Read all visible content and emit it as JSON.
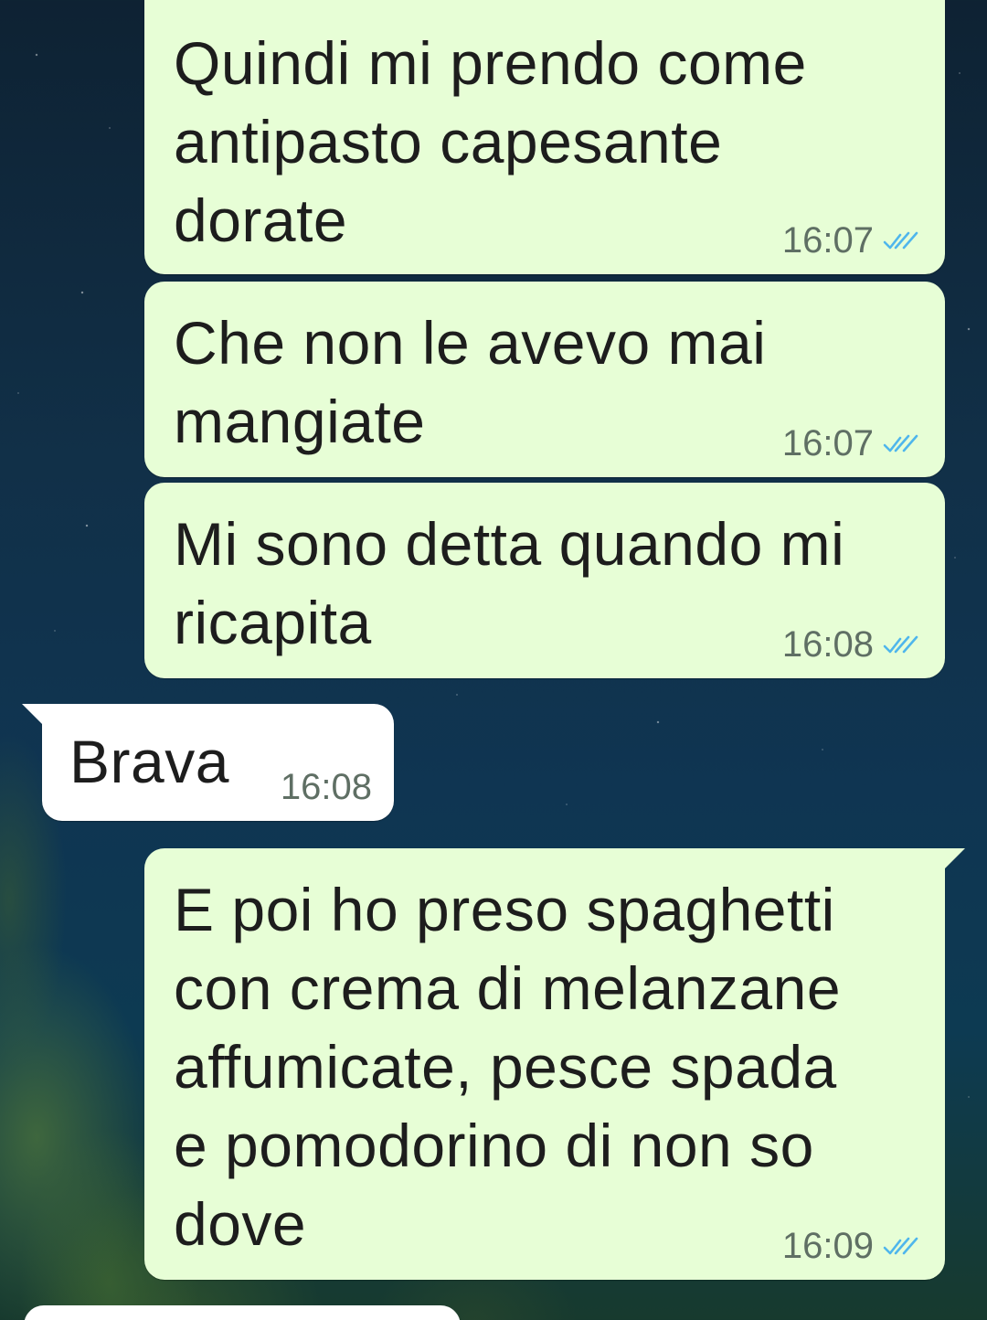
{
  "messages": [
    {
      "direction": "outgoing",
      "text": "Quindi mi prendo come\nantipasto capesante\ndorate",
      "time": "16:07",
      "status_icon": "double-check-read-icon"
    },
    {
      "direction": "outgoing",
      "text": "Che non le avevo mai\nmangiate",
      "time": "16:07",
      "status_icon": "double-check-read-icon"
    },
    {
      "direction": "outgoing",
      "text": "Mi sono detta quando mi\nricapita",
      "time": "16:08",
      "status_icon": "double-check-read-icon"
    },
    {
      "direction": "incoming",
      "text": "Brava",
      "time": "16:08"
    },
    {
      "direction": "outgoing",
      "text": "E poi ho preso spaghetti\ncon crema di melanzane\naffumicate, pesce spada\ne pomodorino di non so\ndove",
      "time": "16:09",
      "status_icon": "double-check-read-icon"
    }
  ],
  "colors": {
    "outgoing_bubble": "#e7fed6",
    "incoming_bubble": "#ffffff",
    "read_ticks": "#4fb6ec",
    "timestamp": "#5f6f64"
  }
}
